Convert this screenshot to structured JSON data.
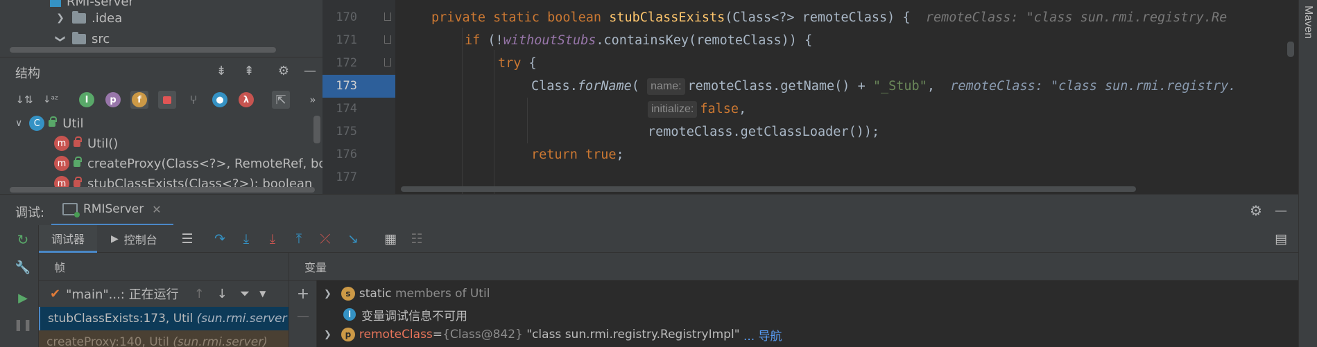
{
  "project_tree": {
    "module_name": "RMI-server",
    "items": [
      {
        "label": ".idea",
        "expanded": false
      },
      {
        "label": "src",
        "expanded": true
      }
    ]
  },
  "structure": {
    "title": "结构",
    "class_name": "Util",
    "class_badge": "C",
    "members": [
      {
        "label": "Util()",
        "badge": "m",
        "access": "private"
      },
      {
        "label": "createProxy(Class<?>, RemoteRef, bool",
        "badge": "m",
        "access": "public"
      },
      {
        "label": "stubClassExists(Class<?>): boolean",
        "badge": "m",
        "access": "private"
      }
    ],
    "toolbar_badges": [
      "f",
      "p",
      "I"
    ]
  },
  "editor": {
    "lines": [
      {
        "no": "170",
        "kw1": "private static boolean ",
        "fn": "stubClassExists",
        "rest": "(Class<?> remoteClass) {",
        "inline": "remoteClass: \"class sun.rmi.registry.Re"
      },
      {
        "no": "171",
        "kw1": "if",
        "rest1": " (!",
        "field": "withoutStubs",
        "rest2": ".containsKey(remoteClass)) {"
      },
      {
        "no": "172",
        "kw1": "try",
        "rest1": " {"
      },
      {
        "no": "173",
        "pre": "Class.",
        "it": "forName",
        "paren": "(",
        "hint": "name:",
        "mid": "remoteClass.getName() + ",
        "str": "\"_Stub\"",
        "comma": ",",
        "inline": "remoteClass: \"class sun.rmi.registry."
      },
      {
        "no": "174",
        "hint": "initialize:",
        "kw": "false",
        "comma": ","
      },
      {
        "no": "175",
        "text": "remoteClass.getClassLoader());"
      },
      {
        "no": "176",
        "kw": "return true",
        "rest": ";"
      },
      {
        "no": "177"
      }
    ]
  },
  "right_strip": {
    "label": "Maven"
  },
  "debug": {
    "title": "调试:",
    "run_config": "RMIServer",
    "tabs": [
      "调试器",
      "控制台"
    ],
    "frames": {
      "header": "帧",
      "thread": "\"main\"...: 正在运行",
      "rows": [
        {
          "method": "stubClassExists:173, Util",
          "pkg": "(sun.rmi.server",
          "selected": true
        },
        {
          "method": "createProxy:140, Util",
          "pkg": "(sun.rmi.server)",
          "selected": false
        }
      ]
    },
    "variables": {
      "header": "变量",
      "rows": [
        {
          "badge": "s",
          "name": "static",
          "desc": "members of Util"
        },
        {
          "badge": "i",
          "text": "变量调试信息不可用"
        },
        {
          "badge": "p",
          "name": "remoteClass",
          "eq": " = ",
          "type": "{Class@842}",
          "value": "\"class sun.rmi.registry.RegistryImpl\"",
          "nav": "... 导航"
        }
      ]
    }
  },
  "colors": {
    "accent": "#4a88c7",
    "exec_line": "#2d5f9a",
    "keyword": "#cc7832",
    "function": "#ffc66d",
    "string": "#6a8759"
  }
}
